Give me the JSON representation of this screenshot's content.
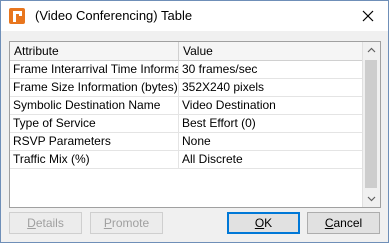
{
  "window": {
    "title": "(Video Conferencing) Table",
    "close_label": "✕"
  },
  "table": {
    "headers": {
      "attribute": "Attribute",
      "value": "Value"
    },
    "rows": [
      {
        "attribute": "Frame Interarrival Time Information",
        "value": "30 frames/sec"
      },
      {
        "attribute": "Frame Size Information (bytes)",
        "value": "352X240 pixels"
      },
      {
        "attribute": "Symbolic Destination Name",
        "value": "Video Destination"
      },
      {
        "attribute": "Type of Service",
        "value": "Best Effort (0)"
      },
      {
        "attribute": "RSVP Parameters",
        "value": "None"
      },
      {
        "attribute": "Traffic Mix (%)",
        "value": "All Discrete"
      }
    ]
  },
  "buttons": {
    "details": {
      "first": "D",
      "rest": "etails"
    },
    "promote": {
      "first": "P",
      "rest": "romote"
    },
    "ok": {
      "first": "O",
      "rest": "K"
    },
    "cancel": {
      "first": "C",
      "rest": "ancel"
    }
  },
  "icons": {
    "app": "app-logo-icon",
    "close": "close-icon"
  }
}
